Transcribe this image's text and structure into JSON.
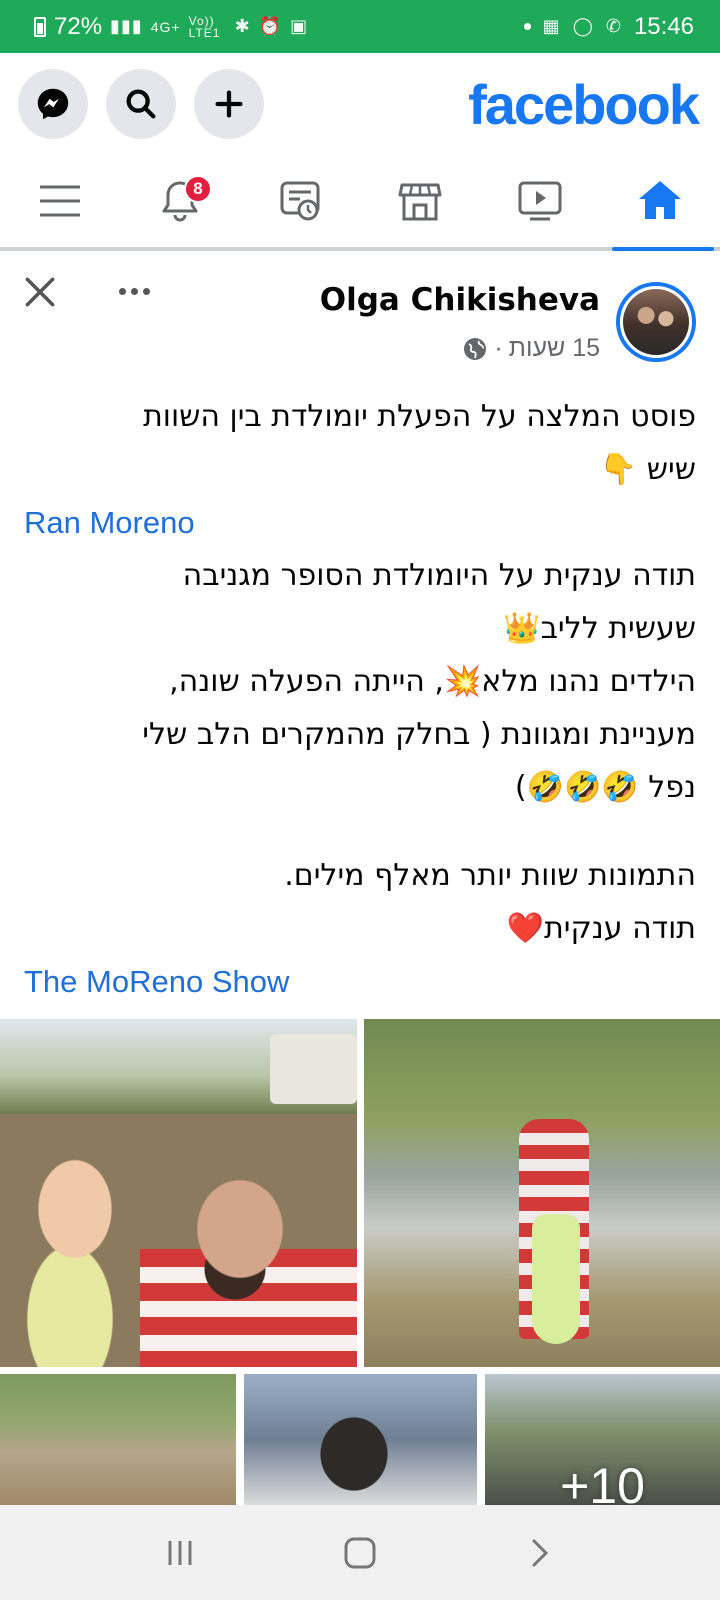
{
  "status_bar": {
    "battery": "72%",
    "time": "15:46",
    "network_label": "4G+",
    "volte_label": "Vo)) LTE1"
  },
  "header": {
    "logo": "facebook"
  },
  "nav": {
    "notifications_badge": "8"
  },
  "post": {
    "author": "Olga Chikisheva",
    "time_ago": "15 שעות",
    "separator": "·",
    "text": {
      "line1": "פוסט המלצה על הפעלת יומולדת בין השוות",
      "line2": "שיש 👇",
      "mention1": "Ran Moreno",
      "line3": "תודה ענקית על היומולדת הסופר מגניבה",
      "line4": "שעשית לליב👑",
      "line5": "הילדים נהנו מלא💥, הייתה הפעלה שונה,",
      "line6": "מעניינת ומגוונת ( בחלק מהמקרים הלב שלי",
      "line7": "נפל 🤣🤣🤣)",
      "line8": "התמונות שוות יותר מאלף מילים.",
      "line9": "תודה ענקית❤️",
      "mention2": "The MoReno Show"
    },
    "more_photos": "+10"
  },
  "colors": {
    "status_green": "#1faa59",
    "facebook_blue": "#1877f2",
    "badge_red": "#e41e3f",
    "link_blue": "#1f6fd6"
  }
}
